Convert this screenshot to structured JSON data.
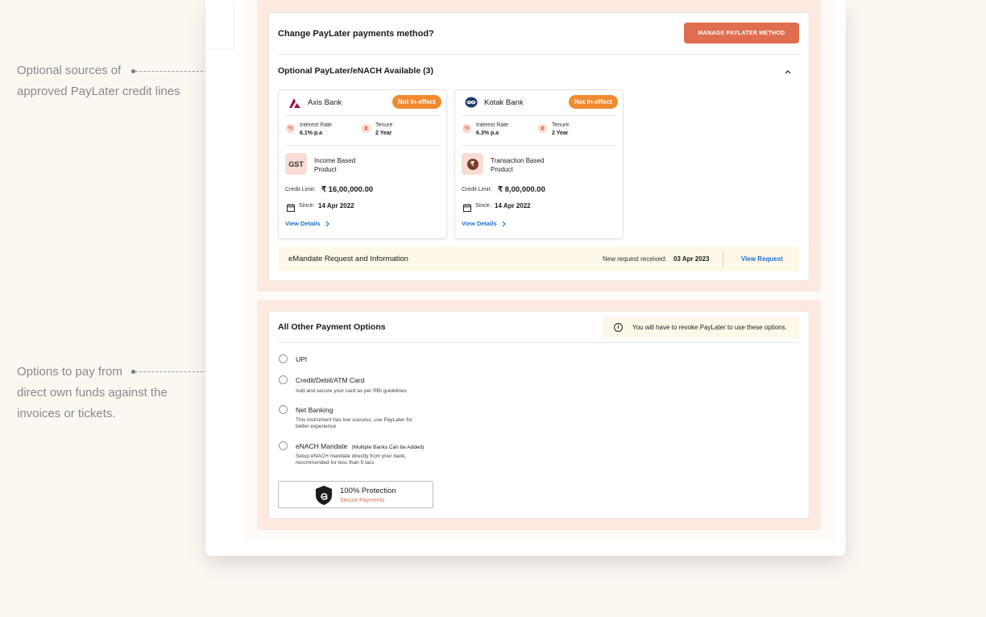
{
  "annotations": {
    "top": [
      "Optional sources of",
      "approved PayLater credit lines"
    ],
    "bottom": [
      "Options to pay from",
      "direct own funds against the",
      "invoices or tickets."
    ]
  },
  "change_section": {
    "title": "Change PayLater payments method?",
    "manage_button": "MANAGE PAYLATER METHOD",
    "optional_title": "Optional PayLater/eNACH Available (3)",
    "cards": [
      {
        "bank": "Axis Bank",
        "badge": "Not In-effect",
        "interest_label": "Interest Rate",
        "interest_value": "6.1% p.a",
        "tenure_label": "Tenure",
        "tenure_value": "2 Year",
        "product_icon_text": "GST",
        "product_line1": "Income Based",
        "product_line2": "Product",
        "credit_label": "Credit Limit:",
        "credit_value": "₹ 16,00,000.00",
        "since_label": "Since:",
        "since_value": "14 Apr 2022",
        "view_details": "View Details"
      },
      {
        "bank": "Kotak Bank",
        "badge": "Not In-effect",
        "interest_label": "Interest Rate",
        "interest_value": "6.3% p.a",
        "tenure_label": "Tenure",
        "tenure_value": "2 Year",
        "product_icon_text": "₹",
        "product_line1": "Transaction Based",
        "product_line2": "Product",
        "credit_label": "Credit Limit:",
        "credit_value": "₹ 8,00,000.00",
        "since_label": "Since:",
        "since_value": "14 Apr 2022",
        "view_details": "View Details"
      }
    ],
    "emandate": {
      "title": "eMandate Request and Information",
      "received_label": "New request received:",
      "received_date": "03 Apr 2023",
      "view_request": "View Request"
    }
  },
  "other_section": {
    "title": "All Other Payment Options",
    "notice": "You will have to revoke PayLater to use these options.",
    "options": [
      {
        "label": "UPI",
        "extra": "",
        "desc1": "",
        "desc2": ""
      },
      {
        "label": "Credit/Debit/ATM Card",
        "extra": "",
        "desc1": "Add and secure your card as per RBI guidelines",
        "desc2": ""
      },
      {
        "label": "Net Banking",
        "extra": "",
        "desc1": "This instrument has low success, use PayLater for",
        "desc2": "better experience"
      },
      {
        "label": "eNACH Mandate",
        "extra": "(Multiple Banks Can be Added)",
        "desc1": "Setup eNACH mandate directly from your bank,",
        "desc2": "recommended for less than 5 lacs"
      }
    ],
    "protection": {
      "title": "100% Protection",
      "subtitle": "Secure Payments"
    }
  },
  "colors": {
    "accent": "#e06d4f",
    "badge": "#f28a2e",
    "link": "#1f6fd1",
    "section_bg": "#fde9e0"
  }
}
